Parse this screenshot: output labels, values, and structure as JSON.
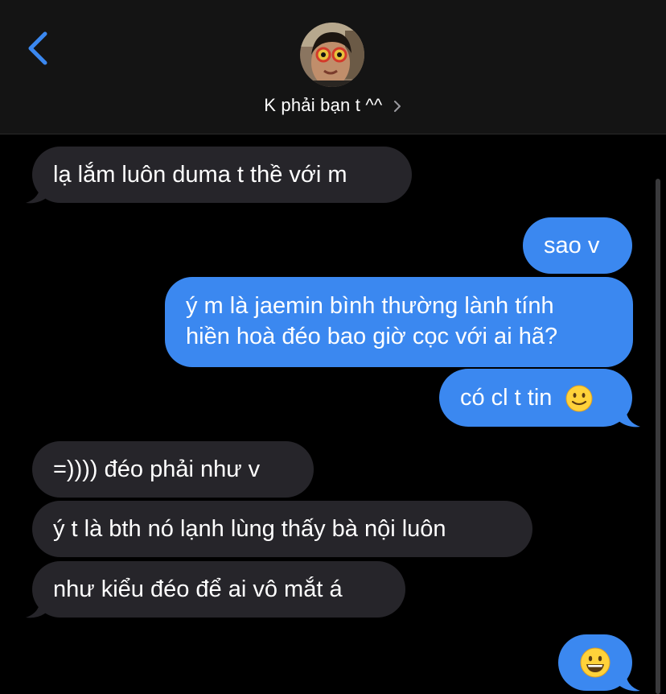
{
  "header": {
    "contact_name": "K phải bạn t ^^",
    "back_icon": "chevron-left-icon",
    "chevron_icon": "chevron-right-icon",
    "accent": "#3b88f0"
  },
  "messages": [
    {
      "direction": "received",
      "text": "lạ lắm luôn duma t thề với m"
    },
    {
      "direction": "sent",
      "text": "sao v"
    },
    {
      "direction": "sent",
      "line1": "ý m là jaemin bình thường lành tính",
      "line2": "hiền hoà đéo bao giờ cọc với ai hã?"
    },
    {
      "direction": "sent",
      "text": "có cl t tin",
      "emoji": "slightly-smiling-face"
    },
    {
      "direction": "received",
      "text": "=)))) đéo phải như v"
    },
    {
      "direction": "received",
      "text": "ý t là bth nó lạnh lùng thấy bà nội luôn"
    },
    {
      "direction": "received",
      "text": "như kiểu đéo để ai vô mắt á"
    },
    {
      "direction": "sent",
      "emoji": "grinning-face"
    }
  ],
  "colors": {
    "received_bubble": "#26252a",
    "sent_bubble": "#3b88f0",
    "background": "#000000"
  }
}
